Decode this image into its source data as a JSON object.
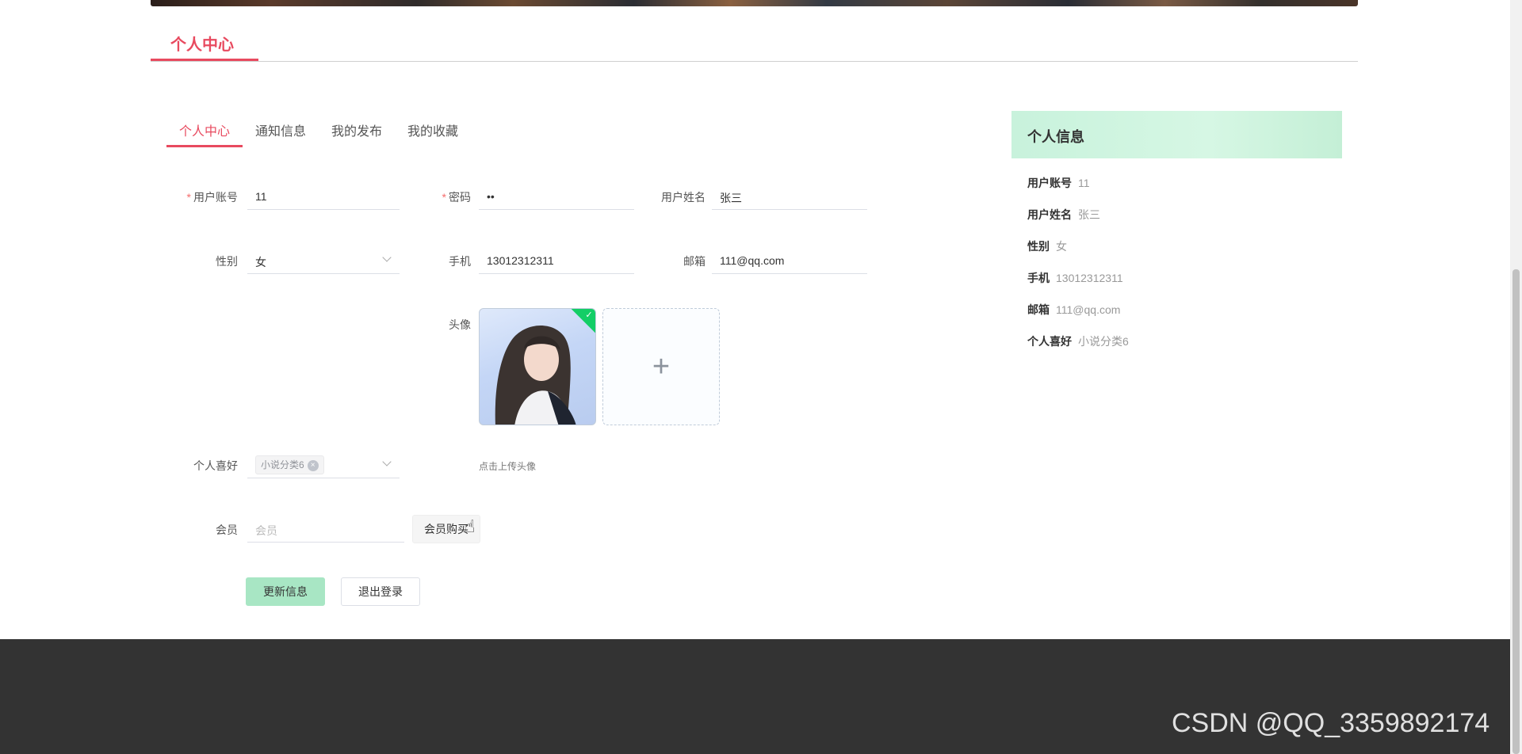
{
  "page": {
    "title": "个人中心"
  },
  "tabs": [
    {
      "label": "个人中心",
      "active": true
    },
    {
      "label": "通知信息",
      "active": false
    },
    {
      "label": "我的发布",
      "active": false
    },
    {
      "label": "我的收藏",
      "active": false
    }
  ],
  "form": {
    "account": {
      "label": "用户账号",
      "value": "11",
      "required": true
    },
    "password": {
      "label": "密码",
      "value": "••",
      "required": true
    },
    "name": {
      "label": "用户姓名",
      "value": "张三"
    },
    "gender": {
      "label": "性别",
      "value": "女"
    },
    "phone": {
      "label": "手机",
      "value": "13012312311"
    },
    "email": {
      "label": "邮箱",
      "value": "111@qq.com"
    },
    "avatar": {
      "label": "头像",
      "upload_tip": "点击上传头像"
    },
    "hobby": {
      "label": "个人喜好",
      "tag": "小说分类6"
    },
    "member": {
      "label": "会员",
      "placeholder": "会员",
      "buy_button": "会员购买"
    },
    "update_button": "更新信息",
    "logout_button": "退出登录"
  },
  "info_panel": {
    "title": "个人信息",
    "rows": [
      {
        "label": "用户账号",
        "value": "11"
      },
      {
        "label": "用户姓名",
        "value": "张三"
      },
      {
        "label": "性别",
        "value": "女"
      },
      {
        "label": "手机",
        "value": "13012312311"
      },
      {
        "label": "邮箱",
        "value": "111@qq.com"
      },
      {
        "label": "个人喜好",
        "value": "小说分类6"
      }
    ]
  },
  "watermark": "CSDN @QQ_3359892174",
  "colors": {
    "accent": "#e84a5f",
    "success": "#13ce66",
    "panel_header": "#c8f2dc",
    "footer": "#333333"
  }
}
